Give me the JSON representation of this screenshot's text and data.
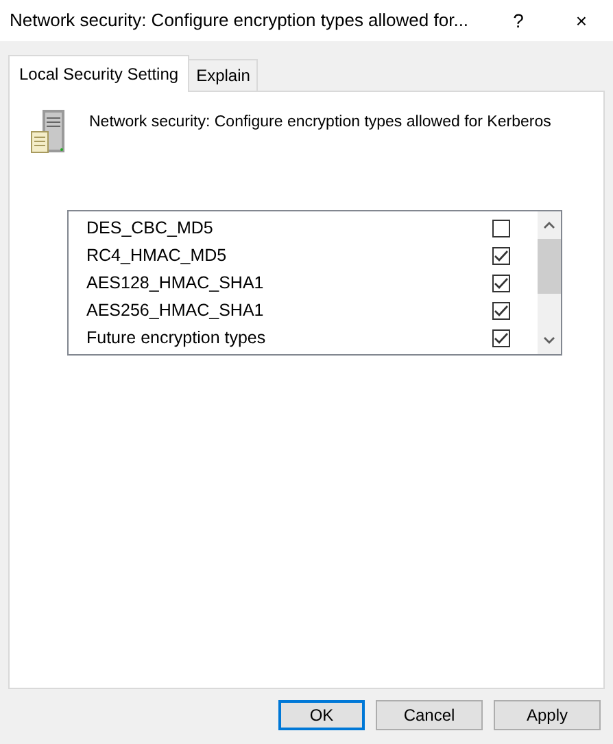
{
  "window": {
    "title": "Network security: Configure encryption types allowed for...",
    "help": "?",
    "close": "×"
  },
  "tabs": [
    {
      "label": "Local Security Setting",
      "selected": true
    },
    {
      "label": "Explain",
      "selected": false
    }
  ],
  "policy": {
    "description": "Network security: Configure encryption types allowed for Kerberos"
  },
  "encryption_types": [
    {
      "name": "DES_CBC_MD5",
      "checked": false
    },
    {
      "name": "RC4_HMAC_MD5",
      "checked": true
    },
    {
      "name": "AES128_HMAC_SHA1",
      "checked": true
    },
    {
      "name": "AES256_HMAC_SHA1",
      "checked": true
    },
    {
      "name": "Future encryption types",
      "checked": true
    }
  ],
  "buttons": [
    {
      "label": "OK",
      "default": true
    },
    {
      "label": "Cancel",
      "default": false
    },
    {
      "label": "Apply",
      "default": false
    }
  ]
}
